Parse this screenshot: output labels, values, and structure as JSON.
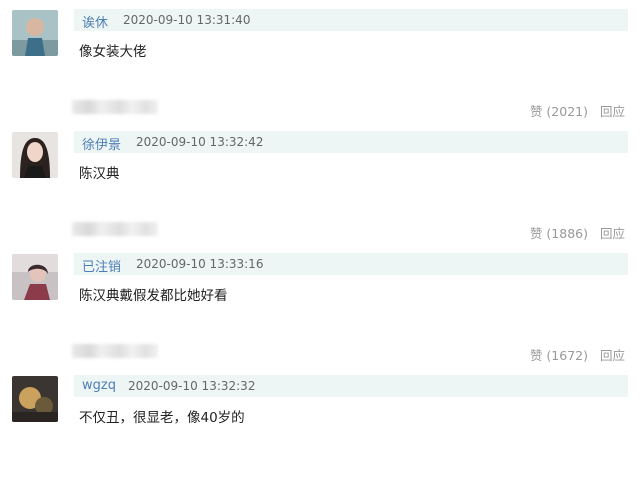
{
  "comments": [
    {
      "user": "诶休",
      "time": "2020-09-10 13:31:40",
      "content": "像女装大佬",
      "like_label": "赞 (2021)",
      "reply_label": "回应"
    },
    {
      "user": "徐伊景",
      "time": "2020-09-10 13:32:42",
      "content": "陈汉典",
      "like_label": "赞 (1886)",
      "reply_label": "回应"
    },
    {
      "user": "已注销",
      "time": "2020-09-10 13:33:16",
      "content": "陈汉典戴假发都比她好看",
      "like_label": "赞 (1672)",
      "reply_label": "回应"
    },
    {
      "user": "wgzq",
      "time": "2020-09-10 13:32:32",
      "content": "不仅丑，很显老，像40岁的"
    }
  ],
  "colors": {
    "username": "#4d7fb3",
    "meta_bar_bg": "#eef5f5",
    "action_text": "#999999"
  }
}
